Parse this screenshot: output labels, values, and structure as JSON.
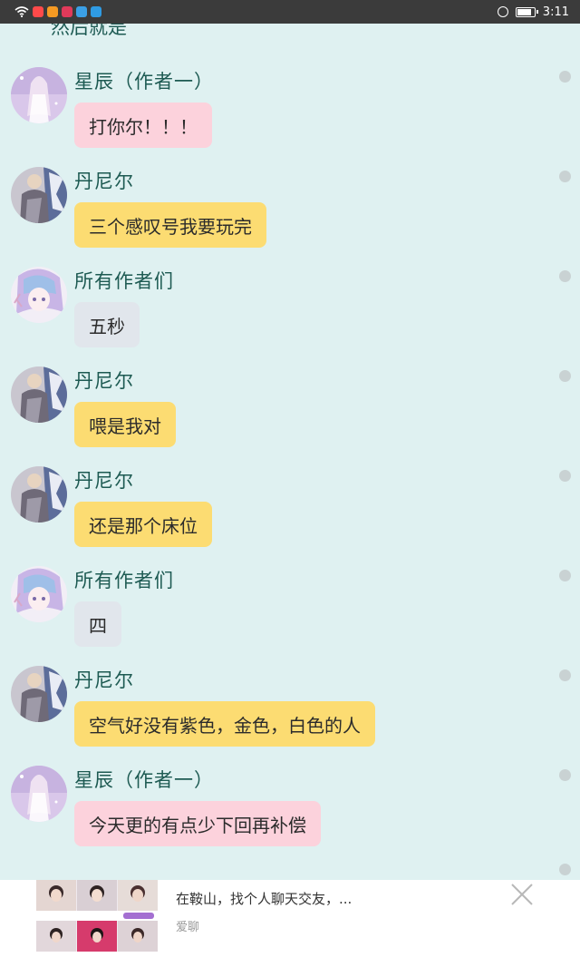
{
  "status_bar": {
    "time": "3:11",
    "app_icon_colors": [
      "#ff4a4a",
      "#f59a23",
      "#e13a5a",
      "#3ba0e6",
      "#2f9be3"
    ]
  },
  "chat": {
    "cut_off_text": "然后就是",
    "messages": [
      {
        "sender": "星辰（作者一）",
        "text": "打你尔！！！",
        "bubble_color": "pink",
        "avatar": "xingchen-avatar"
      },
      {
        "sender": "丹尼尔",
        "text": "三个感叹号我要玩完",
        "bubble_color": "yellow",
        "avatar": "danier-avatar"
      },
      {
        "sender": "所有作者们",
        "text": "五秒",
        "bubble_color": "gray",
        "avatar": "all-authors-avatar"
      },
      {
        "sender": "丹尼尔",
        "text": "喂是我对",
        "bubble_color": "yellow",
        "avatar": "danier-avatar"
      },
      {
        "sender": "丹尼尔",
        "text": "还是那个床位",
        "bubble_color": "yellow",
        "avatar": "danier-avatar"
      },
      {
        "sender": "所有作者们",
        "text": "四",
        "bubble_color": "gray",
        "avatar": "all-authors-avatar"
      },
      {
        "sender": "丹尼尔",
        "text": "空气好没有紫色，金色，白色的人",
        "bubble_color": "yellow",
        "avatar": "danier-avatar"
      },
      {
        "sender": "星辰（作者一）",
        "text": "今天更的有点少下回再补偿",
        "bubble_color": "pink",
        "avatar": "xingchen-avatar"
      }
    ]
  },
  "ad": {
    "title": "在鞍山，找个人聊天交友，...",
    "source": "爱聊",
    "close_icon": "close-icon"
  }
}
